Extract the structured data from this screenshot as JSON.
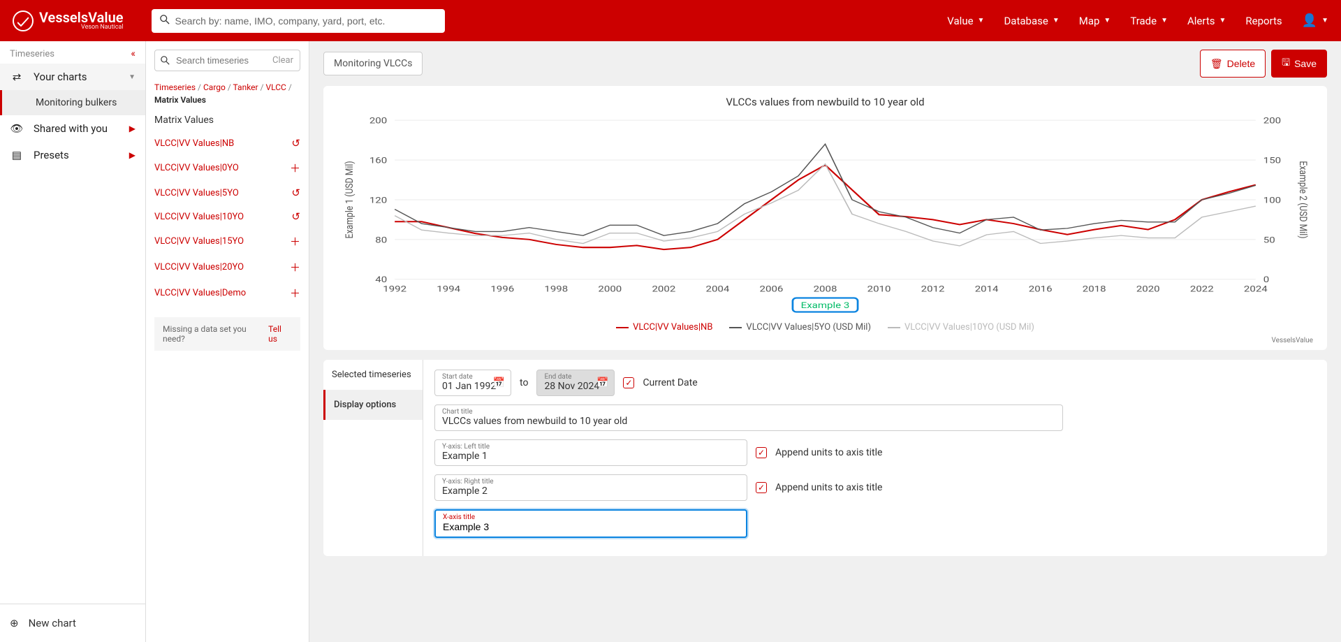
{
  "brand": {
    "title": "VesselsValue",
    "sub": "Veson Nautical"
  },
  "search_placeholder": "Search by: name, IMO, company, yard, port, etc.",
  "nav": {
    "value": "Value",
    "database": "Database",
    "map": "Map",
    "trade": "Trade",
    "alerts": "Alerts",
    "reports": "Reports"
  },
  "sidebar1": {
    "header": "Timeseries",
    "your_charts": "Your charts",
    "sub_item": "Monitoring bulkers",
    "shared": "Shared with you",
    "presets": "Presets",
    "new_chart": "New chart"
  },
  "sidebar2": {
    "search_placeholder": "Search timeseries",
    "clear": "Clear",
    "bc": [
      "Timeseries",
      "Cargo",
      "Tanker",
      "VLCC"
    ],
    "bc_current": "Matrix Values",
    "section": "Matrix Values",
    "items": [
      {
        "label": "VLCC|VV Values|NB",
        "icon": "undo"
      },
      {
        "label": "VLCC|VV Values|0YO",
        "icon": "plus"
      },
      {
        "label": "VLCC|VV Values|5YO",
        "icon": "undo"
      },
      {
        "label": "VLCC|VV Values|10YO",
        "icon": "undo"
      },
      {
        "label": "VLCC|VV Values|15YO",
        "icon": "plus"
      },
      {
        "label": "VLCC|VV Values|20YO",
        "icon": "plus"
      },
      {
        "label": "VLCC|VV Values|Demo",
        "icon": "plus"
      }
    ],
    "missing_q": "Missing a data set you need?",
    "tellus": "Tell us"
  },
  "main": {
    "title_input": "Monitoring VLCCs",
    "delete": "Delete",
    "save": "Save",
    "xaxis_badge": "Example 3",
    "attrib": "VesselsValue",
    "legend": [
      {
        "label": "VLCC|VV Values|NB",
        "color": "#cc0000"
      },
      {
        "label": "VLCC|VV Values|5YO (USD Mil)",
        "color": "#555555"
      },
      {
        "label": "VLCC|VV Values|10YO (USD Mil)",
        "color": "#bbbbbb"
      }
    ],
    "tabs": {
      "selected": "Selected timeseries",
      "display": "Display options"
    },
    "dates": {
      "start_lbl": "Start date",
      "start": "01 Jan 1992",
      "to": "to",
      "end_lbl": "End date",
      "end": "28 Nov 2024",
      "current": "Current Date"
    },
    "ct_lbl": "Chart title",
    "ct_val": "VLCCs values from newbuild to 10 year old",
    "yl_lbl": "Y-axis: Left title",
    "yl_val": "Example 1",
    "yr_lbl": "Y-axis: Right title",
    "yr_val": "Example 2",
    "xa_lbl": "X-axis title",
    "xa_val": "Example 3",
    "append": "Append units to axis title"
  },
  "chart_data": {
    "type": "line",
    "title": "VLCCs values from newbuild to 10 year old",
    "xlabel": "Example 3",
    "ylabel_left": "Example 1 (USD Mil)",
    "ylabel_right": "Example 2 (USD Mil)",
    "x_ticks": [
      1992,
      1994,
      1996,
      1998,
      2000,
      2002,
      2004,
      2006,
      2008,
      2010,
      2012,
      2014,
      2016,
      2018,
      2020,
      2022,
      2024
    ],
    "y_ticks_left": [
      40,
      80,
      120,
      160,
      200
    ],
    "y_ticks_right": [
      0,
      50,
      100,
      150,
      200
    ],
    "x": [
      1992,
      1993,
      1994,
      1995,
      1996,
      1997,
      1998,
      1999,
      2000,
      2001,
      2002,
      2003,
      2004,
      2005,
      2006,
      2007,
      2008,
      2009,
      2010,
      2011,
      2012,
      2013,
      2014,
      2015,
      2016,
      2017,
      2018,
      2019,
      2020,
      2021,
      2022,
      2023,
      2024
    ],
    "series": [
      {
        "name": "VLCC|VV Values|NB",
        "axis": "left",
        "color": "#cc0000",
        "values": [
          98,
          98,
          92,
          86,
          82,
          80,
          75,
          72,
          72,
          74,
          70,
          72,
          80,
          100,
          120,
          140,
          155,
          130,
          105,
          103,
          100,
          95,
          100,
          96,
          90,
          85,
          90,
          94,
          90,
          100,
          120,
          128,
          135
        ]
      },
      {
        "name": "VLCC|VV Values|5YO (USD Mil)",
        "axis": "right",
        "color": "#555555",
        "values": [
          88,
          70,
          65,
          60,
          60,
          65,
          60,
          55,
          68,
          68,
          55,
          60,
          70,
          95,
          110,
          130,
          170,
          100,
          85,
          78,
          65,
          58,
          75,
          78,
          62,
          64,
          70,
          74,
          72,
          72,
          100,
          108,
          118
        ]
      },
      {
        "name": "VLCC|VV Values|10YO (USD Mil)",
        "axis": "right",
        "color": "#bbbbbb",
        "values": [
          80,
          62,
          58,
          55,
          55,
          58,
          50,
          45,
          58,
          58,
          48,
          52,
          60,
          82,
          96,
          112,
          145,
          82,
          70,
          60,
          48,
          42,
          56,
          60,
          45,
          48,
          52,
          55,
          52,
          52,
          78,
          85,
          92
        ]
      }
    ]
  }
}
